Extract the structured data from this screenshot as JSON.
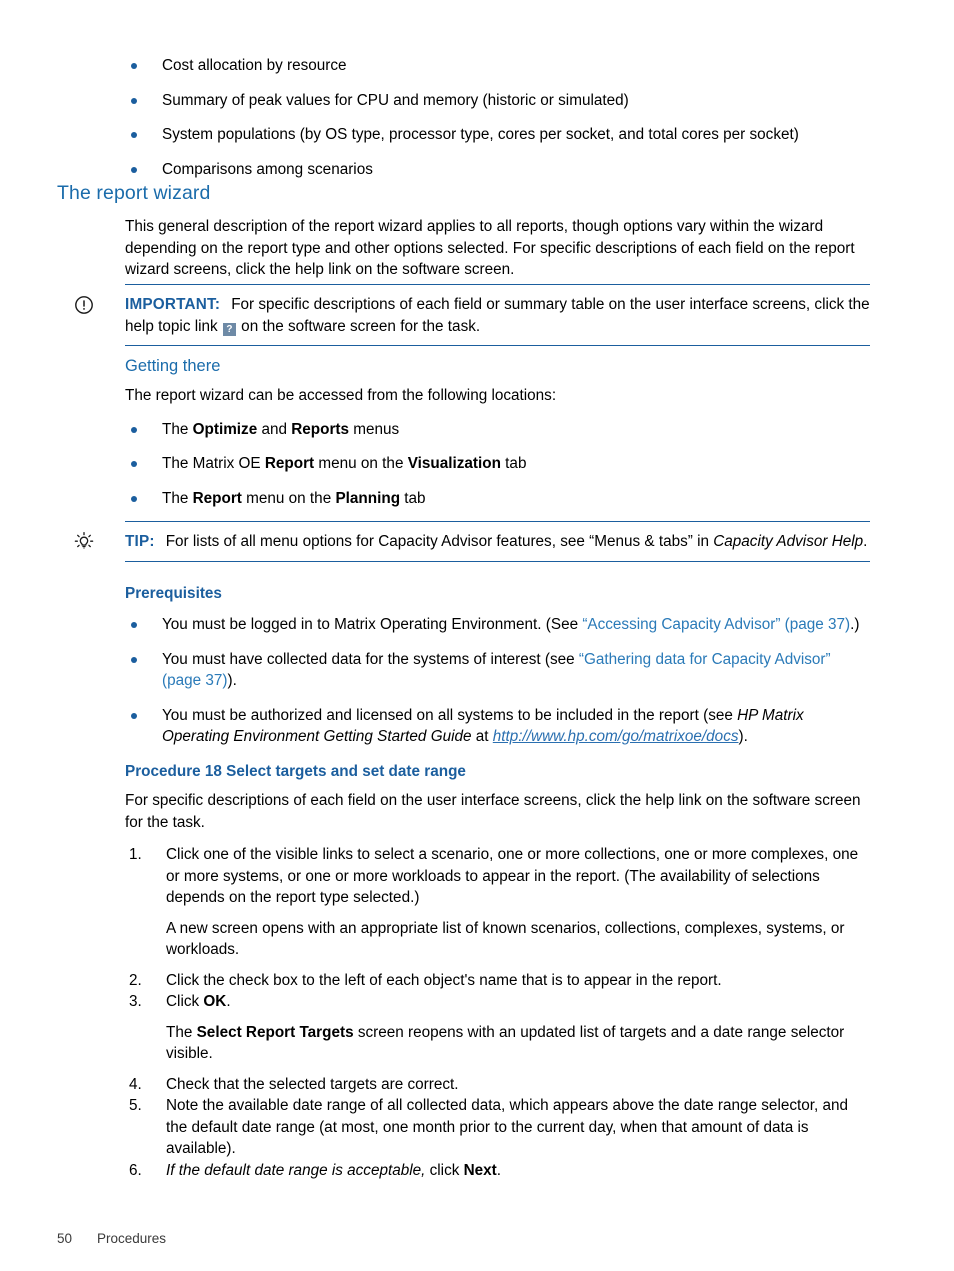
{
  "colors": {
    "heading_blue": "#1b6cab",
    "bold_blue": "#1b5e9e",
    "link_blue": "#2a7ab8",
    "bullet_blue": "#1b5e9e",
    "rule_blue": "#1b5e9e"
  },
  "top_bullets": [
    "Cost allocation by resource",
    "Summary of peak values for CPU and memory (historic or simulated)",
    "System populations (by OS type, processor type, cores per socket, and total cores per socket)",
    "Comparisons among scenarios"
  ],
  "section": {
    "title": "The report wizard",
    "intro": "This general description of the report wizard applies to all reports, though options vary within the wizard depending on the report type and other options selected. For specific descriptions of each field on the report wizard screens, click the help link on the software screen."
  },
  "important": {
    "icon": "important-circle-exclamation-icon",
    "label": "IMPORTANT:",
    "text_before_icon": "For specific descriptions of each field or summary table on the user interface screens, click the help topic link ",
    "inline_icon_glyph": "?",
    "inline_icon_name": "help-topic-link-icon",
    "text_after_icon": " on the software screen for the task."
  },
  "getting_there": {
    "title": "Getting there",
    "intro": "The report wizard can be accessed from the following locations:",
    "bullets": [
      {
        "prefix": "The ",
        "bold1": "Optimize",
        "mid": " and ",
        "bold2": "Reports",
        "suffix": " menus"
      },
      {
        "prefix": "The Matrix OE ",
        "bold1": "Report",
        "mid": " menu on the ",
        "bold2": "Visualization",
        "suffix": " tab"
      },
      {
        "prefix": "The ",
        "bold1": "Report",
        "mid": " menu on the ",
        "bold2": "Planning",
        "suffix": " tab"
      }
    ]
  },
  "tip": {
    "icon": "tip-lightbulb-icon",
    "label": "TIP:",
    "text_plain_1": "For lists of all menu options for Capacity Advisor features, see “Menus & tabs” in ",
    "text_italic": "Capacity Advisor Help",
    "text_plain_2": "."
  },
  "prerequisites": {
    "title": "Prerequisites",
    "items": [
      {
        "lead": "You must be logged in to Matrix Operating Environment. (See ",
        "link": "“Accessing Capacity Advisor” (page 37)",
        "tail": ".)"
      },
      {
        "lead": "You must have collected data for the systems of interest (see ",
        "link": "“Gathering data for Capacity Advisor” (page 37)",
        "tail": ")."
      },
      {
        "lead": "You must be authorized and licensed on all systems to be included in the report (see ",
        "italic": "HP Matrix Operating Environment Getting Started Guide",
        "mid": " at ",
        "url": "http://www.hp.com/go/matrixoe/docs",
        "tail": ")."
      }
    ]
  },
  "procedure": {
    "title": "Procedure 18 Select targets and set date range",
    "intro": "For specific descriptions of each field on the user interface screens, click the help link on the software screen for the task.",
    "steps": [
      {
        "text": "Click one of the visible links to select a scenario, one or more collections, one or more complexes, one or more systems, or one or more workloads to appear in the report. (The availability of selections depends on the report type selected.)",
        "follow": "A new screen opens with an appropriate list of known scenarios, collections, complexes, systems, or workloads."
      },
      {
        "text": "Click the check box to the left of each object's name that is to appear in the report."
      },
      {
        "text_lead": "Click ",
        "text_bold": "OK",
        "text_tail": ".",
        "follow_lead": "The ",
        "follow_bold": "Select Report Targets",
        "follow_tail": " screen reopens with an updated list of targets and a date range selector visible."
      },
      {
        "text": "Check that the selected targets are correct."
      },
      {
        "text": "Note the available date range of all collected data, which appears above the date range selector, and the default date range (at most, one month prior to the current day, when that amount of data is available)."
      },
      {
        "text_italic": "If the default date range is acceptable,",
        "text_lead": " click ",
        "text_bold": "Next",
        "text_tail": "."
      }
    ]
  },
  "footer": {
    "page_number": "50",
    "chapter": "Procedures"
  }
}
